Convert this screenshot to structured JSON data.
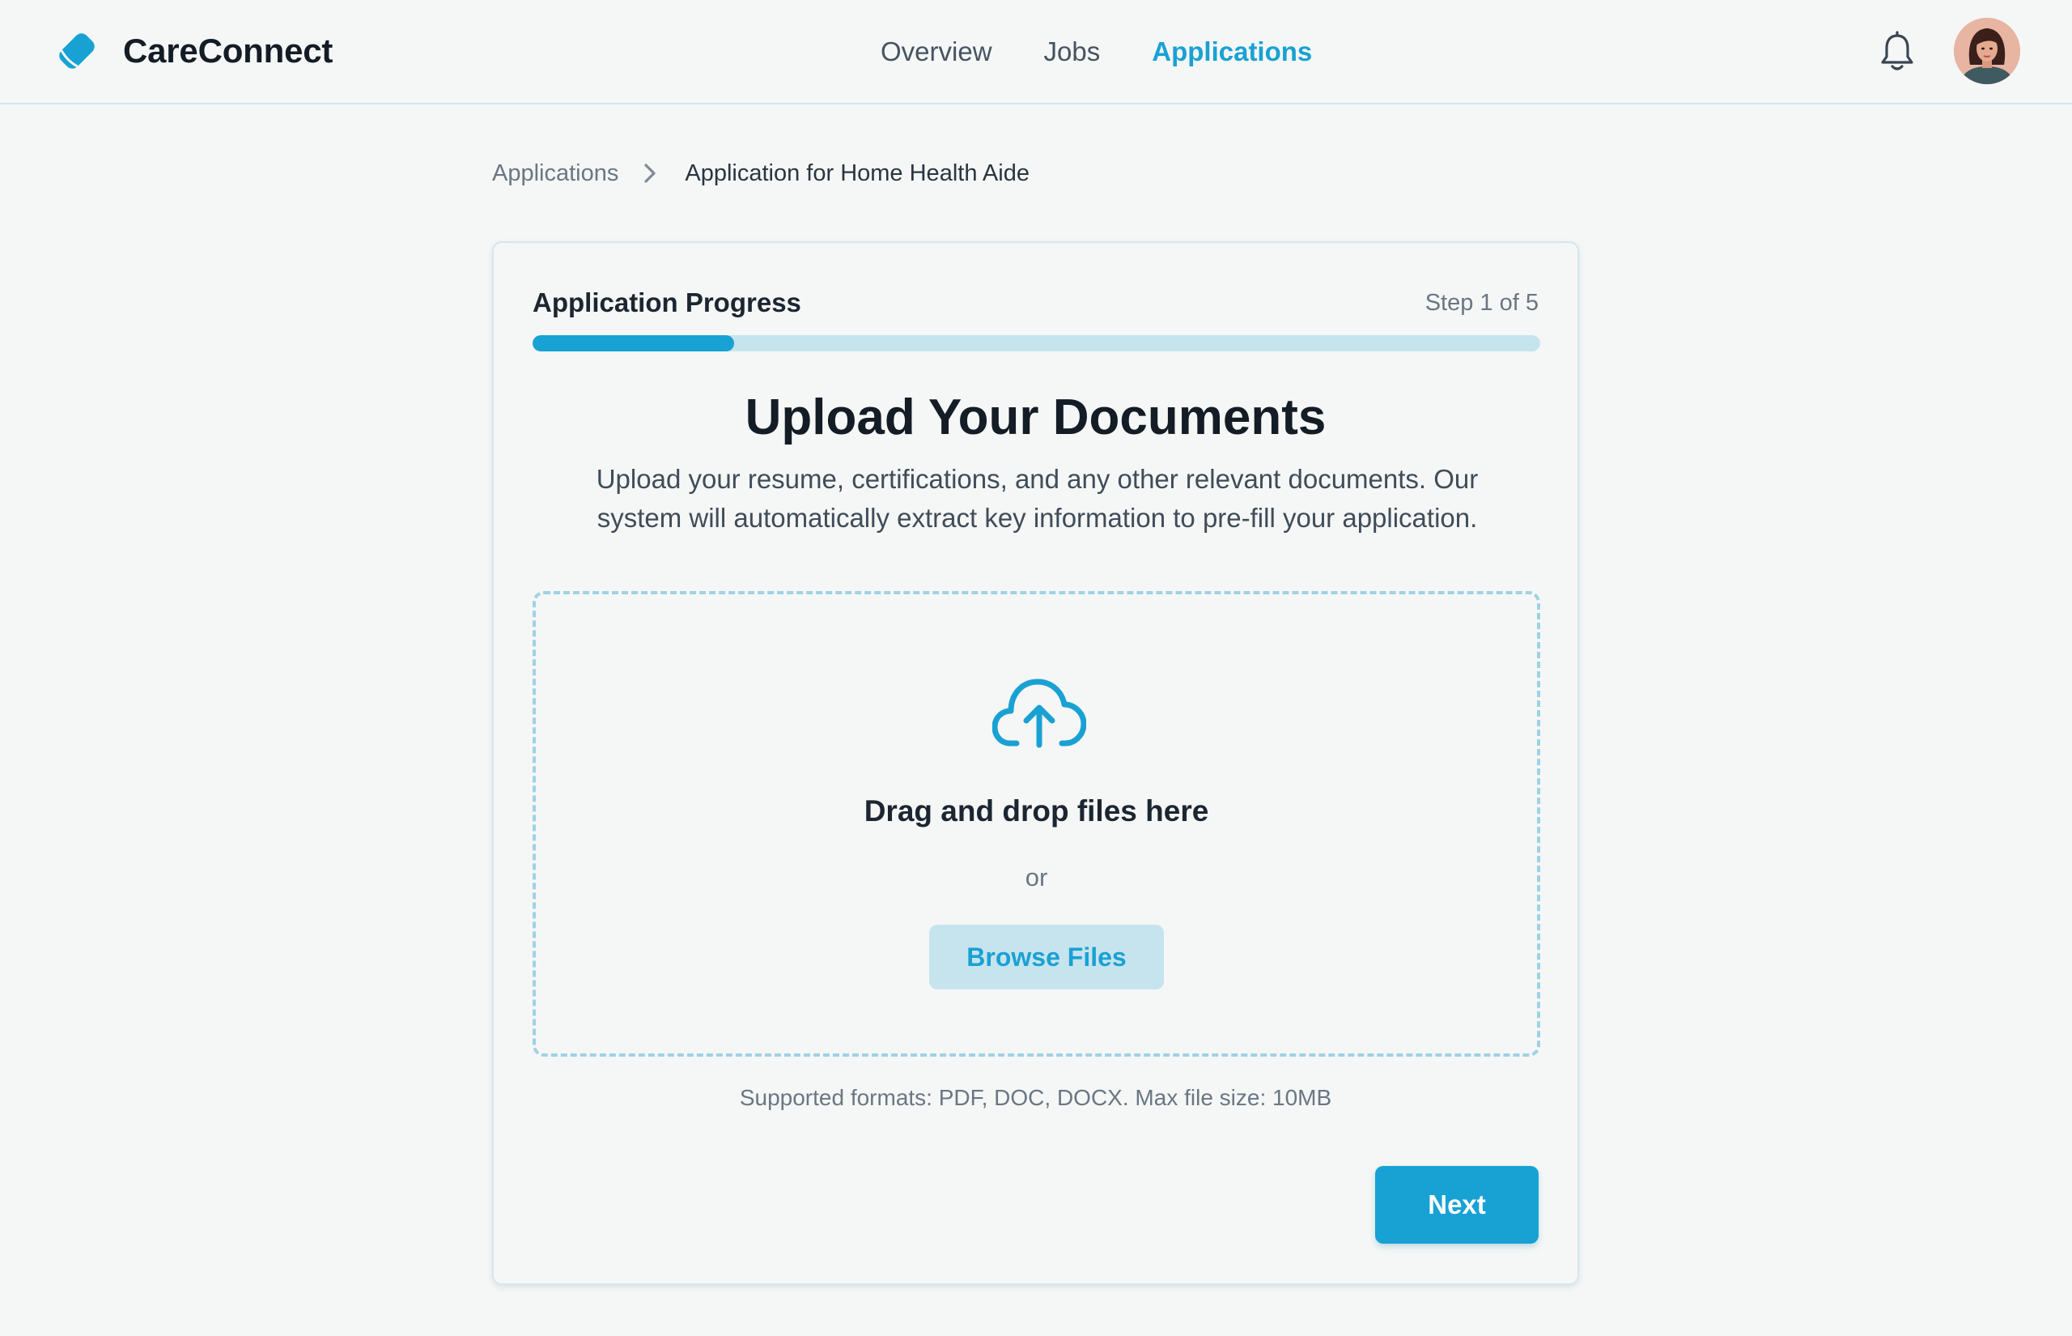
{
  "brand": {
    "name": "CareConnect",
    "logo_icon": "tag-logo-icon",
    "accent_color": "#18a2d4"
  },
  "nav": {
    "items": [
      {
        "label": "Overview",
        "active": false
      },
      {
        "label": "Jobs",
        "active": false
      },
      {
        "label": "Applications",
        "active": true
      }
    ]
  },
  "header_icons": {
    "notifications": "bell-icon",
    "profile": "user-avatar"
  },
  "breadcrumb": {
    "parent": "Applications",
    "separator_icon": "chevron-right-icon",
    "current": "Application for Home Health Aide"
  },
  "progress": {
    "title": "Application Progress",
    "step_label": "Step 1 of 5",
    "fraction": 0.2
  },
  "upload": {
    "title": "Upload Your Documents",
    "description": "Upload your resume, certifications, and any other relevant documents. Our system will automatically extract key information to pre-fill your application.",
    "icon": "cloud-upload-icon",
    "drag_text": "Drag and drop files here",
    "or_text": "or",
    "browse_label": "Browse Files",
    "formats_text": "Supported formats: PDF, DOC, DOCX. Max file size: 10MB"
  },
  "actions": {
    "next_label": "Next"
  }
}
